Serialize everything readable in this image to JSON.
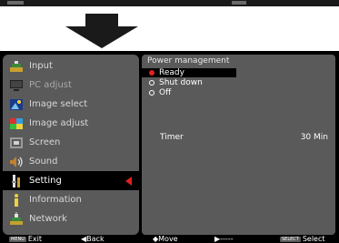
{
  "menu": {
    "items": [
      {
        "label": "Input",
        "icon": "input-icon",
        "dimmed": false,
        "active": false
      },
      {
        "label": "PC adjust",
        "icon": "pc-adjust-icon",
        "dimmed": true,
        "active": false
      },
      {
        "label": "Image select",
        "icon": "image-select-icon",
        "dimmed": false,
        "active": false
      },
      {
        "label": "Image adjust",
        "icon": "image-adjust-icon",
        "dimmed": false,
        "active": false
      },
      {
        "label": "Screen",
        "icon": "screen-icon",
        "dimmed": false,
        "active": false
      },
      {
        "label": "Sound",
        "icon": "sound-icon",
        "dimmed": false,
        "active": false
      },
      {
        "label": "Setting",
        "icon": "setting-icon",
        "dimmed": false,
        "active": true
      },
      {
        "label": "Information",
        "icon": "information-icon",
        "dimmed": false,
        "active": false
      },
      {
        "label": "Network",
        "icon": "network-icon",
        "dimmed": false,
        "active": false
      }
    ]
  },
  "submenu": {
    "title": "Power management",
    "options": [
      {
        "label": "Ready",
        "selected": true
      },
      {
        "label": "Shut down",
        "selected": false
      },
      {
        "label": "Off",
        "selected": false
      }
    ],
    "timer_label": "Timer",
    "timer_value": "30 Min"
  },
  "statusbar": {
    "menu_key": "MENU",
    "exit_label": "Exit",
    "back_label": "◀Back",
    "move_label": "◆Move",
    "next_label": "▶-----",
    "select_key": "SELECT",
    "select_label": "Select"
  },
  "colors": {
    "accent": "#e22020",
    "panel_gray": "#5a5a5a",
    "background": "#000000"
  }
}
